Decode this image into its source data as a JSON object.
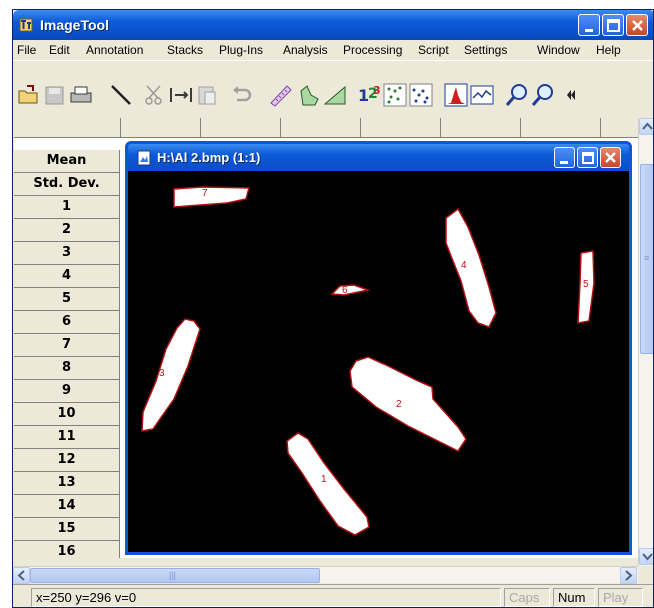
{
  "app": {
    "title": "ImageTool",
    "accent": "#0a4fc9"
  },
  "menu": [
    "File",
    "Edit",
    "Annotation",
    "Stacks",
    "Plug-Ins",
    "Analysis",
    "Processing",
    "Script",
    "Settings",
    "Window",
    "Help"
  ],
  "toolbar": {
    "icons": [
      "open-icon",
      "save-icon",
      "print-icon",
      "line-tool-icon",
      "cut-icon",
      "copy-icon",
      "paste-icon",
      "undo-icon",
      "ruler-icon",
      "freehand-icon",
      "angle-icon",
      "count-icon",
      "points-icon",
      "scatter-icon",
      "histogram-icon",
      "profile-icon",
      "zoom-in-icon",
      "zoom-out-icon",
      "more-icon"
    ]
  },
  "grid": {
    "row_headers": [
      "Mean",
      "Std. Dev.",
      "1",
      "2",
      "3",
      "4",
      "5",
      "6",
      "7",
      "8",
      "9",
      "10",
      "11",
      "12",
      "13",
      "14",
      "15",
      "16"
    ]
  },
  "image_window": {
    "title": "H:\\Al 2.bmp (1:1)",
    "particle_labels": [
      "1",
      "2",
      "3",
      "4",
      "5",
      "6",
      "7"
    ]
  },
  "status": {
    "coords": "x=250 y=296 v=0",
    "caps": "Caps",
    "num": "Num",
    "play": "Play"
  }
}
